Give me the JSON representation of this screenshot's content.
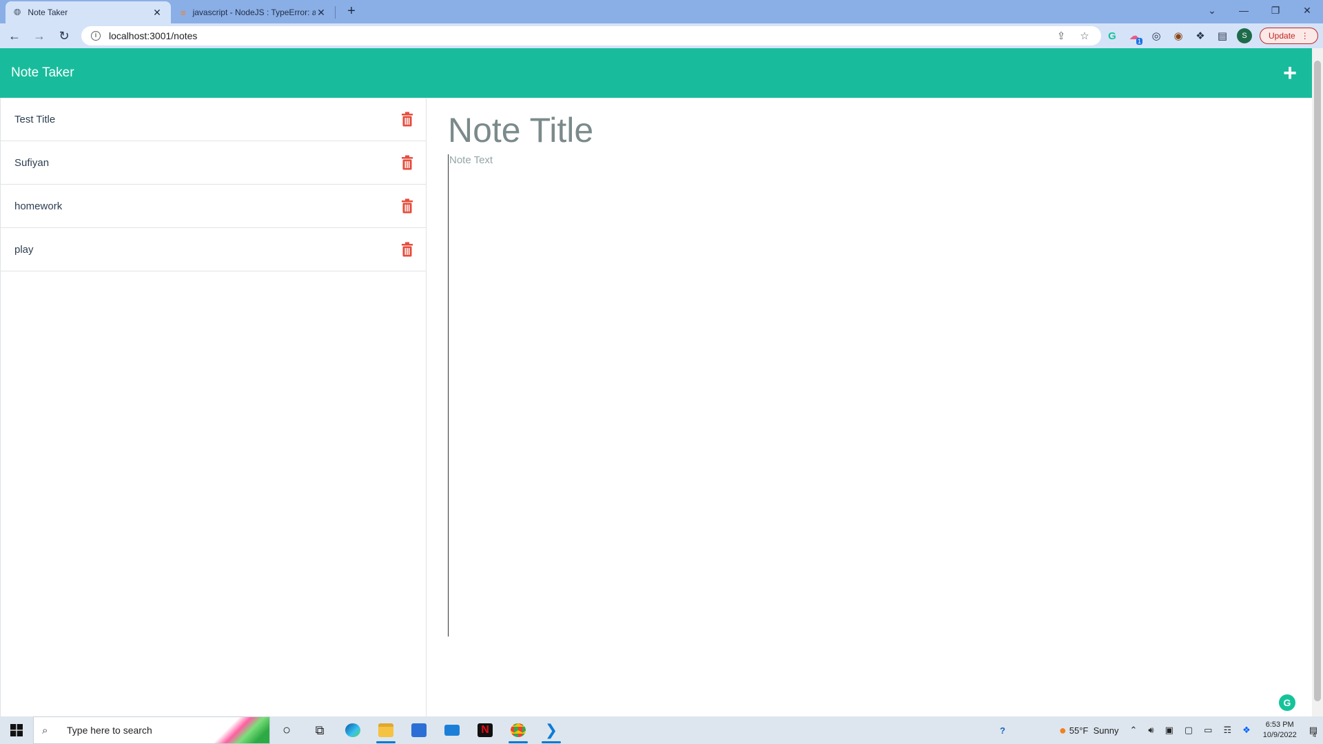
{
  "browser": {
    "tabs": [
      {
        "title": "Note Taker",
        "active": true
      },
      {
        "title": "javascript - NodeJS : TypeError: a",
        "active": false
      }
    ],
    "new_tab_glyph": "+",
    "url": "localhost:3001/notes",
    "update_label": "Update",
    "profile_initial": "S",
    "ext_badge": "1"
  },
  "app": {
    "title": "Note Taker",
    "add_glyph": "+",
    "notes": [
      {
        "title": "Test Title"
      },
      {
        "title": "Sufiyan"
      },
      {
        "title": "homework"
      },
      {
        "title": "play"
      }
    ],
    "editor": {
      "title_placeholder": "Note Title",
      "text_placeholder": "Note Text"
    },
    "colors": {
      "header": "#18bc9c",
      "trash": "#e74c3c",
      "accent_text": "#7b8a8b"
    }
  },
  "taskbar": {
    "search_placeholder": "Type here to search",
    "weather": "55°F  Sunny",
    "time": "6:53 PM",
    "date": "10/9/2022",
    "notification_count": "4"
  }
}
